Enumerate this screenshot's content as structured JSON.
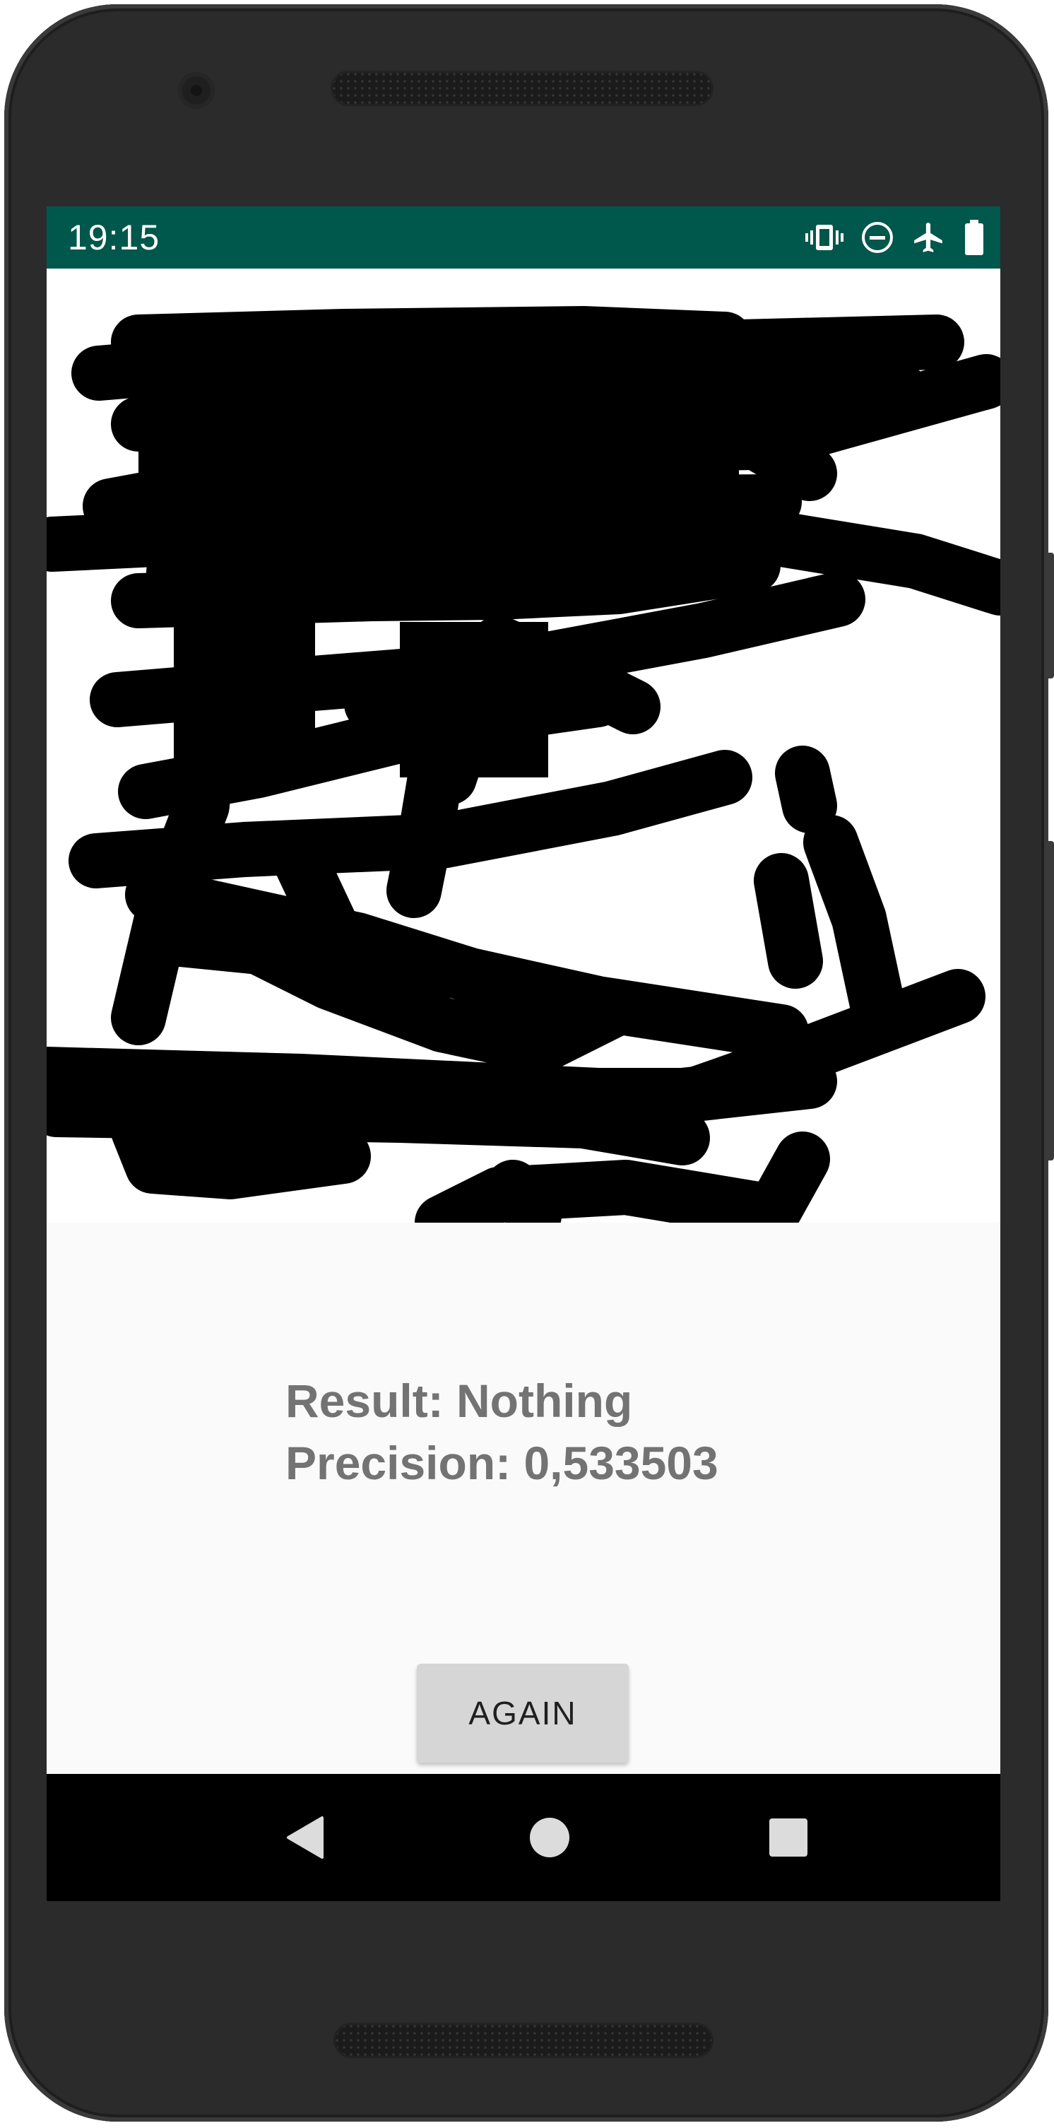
{
  "status_bar": {
    "time": "19:15",
    "background": "#00574b",
    "icons": [
      "vibrate-icon",
      "do-not-disturb-icon",
      "airplane-mode-icon",
      "battery-icon"
    ]
  },
  "drawing_canvas": {
    "stroke_color": "#000000",
    "background": "#ffffff"
  },
  "result": {
    "result_text": "Result: Nothing",
    "precision_text": "Precision: 0,533503"
  },
  "again_button": {
    "label": "AGAIN"
  },
  "nav_bar": {
    "icons": [
      "back-icon",
      "home-icon",
      "recent-apps-icon"
    ]
  }
}
